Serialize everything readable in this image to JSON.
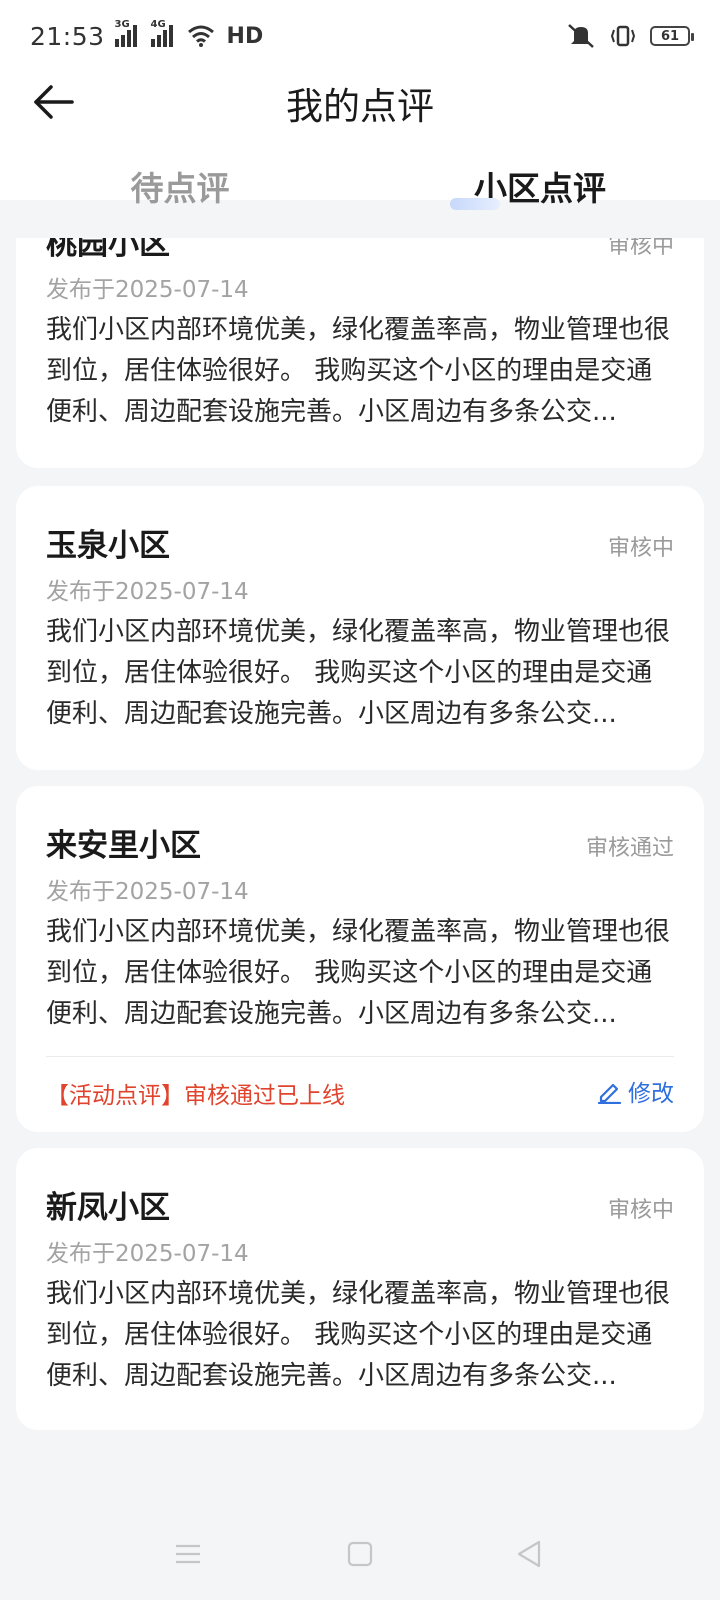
{
  "status_bar": {
    "time": "21:53",
    "signal1_tag": "3G",
    "signal2_tag": "4G",
    "hd_label": "HD",
    "battery": "61"
  },
  "header": {
    "title": "我的点评",
    "tabs": [
      {
        "label": "待点评",
        "active": false
      },
      {
        "label": "小区点评",
        "active": true
      }
    ]
  },
  "reviews": [
    {
      "name": "桃园小区",
      "status": "审核中",
      "date": "发布于2025-07-14",
      "text": "我们小区内部环境优美，绿化覆盖率高，物业管理也很到位，居住体验很好。 我购买这个小区的理由是交通便利、周边配套设施完善。小区周边有多条公交..."
    },
    {
      "name": "玉泉小区",
      "status": "审核中",
      "date": "发布于2025-07-14",
      "text": "我们小区内部环境优美，绿化覆盖率高，物业管理也很到位，居住体验很好。 我购买这个小区的理由是交通便利、周边配套设施完善。小区周边有多条公交..."
    },
    {
      "name": "来安里小区",
      "status": "审核通过",
      "date": "发布于2025-07-14",
      "text": "我们小区内部环境优美，绿化覆盖率高，物业管理也很到位，居住体验很好。 我购买这个小区的理由是交通便利、周边配套设施完善。小区周边有多条公交...",
      "note": "【活动点评】审核通过已上线",
      "edit_label": "修改"
    },
    {
      "name": "新凤小区",
      "status": "审核中",
      "date": "发布于2025-07-14",
      "text": "我们小区内部环境优美，绿化覆盖率高，物业管理也很到位，居住体验很好。 我购买这个小区的理由是交通便利、周边配套设施完善。小区周边有多条公交..."
    }
  ],
  "icons": {
    "back": "arrow-left-icon",
    "edit": "pencil-icon",
    "nav": [
      "menu-icon",
      "home-square-icon",
      "back-triangle-icon"
    ]
  },
  "colors": {
    "accent": "#2f6fde",
    "note": "#e0432e",
    "muted": "#9a9a9a",
    "background": "#f4f5f7"
  }
}
